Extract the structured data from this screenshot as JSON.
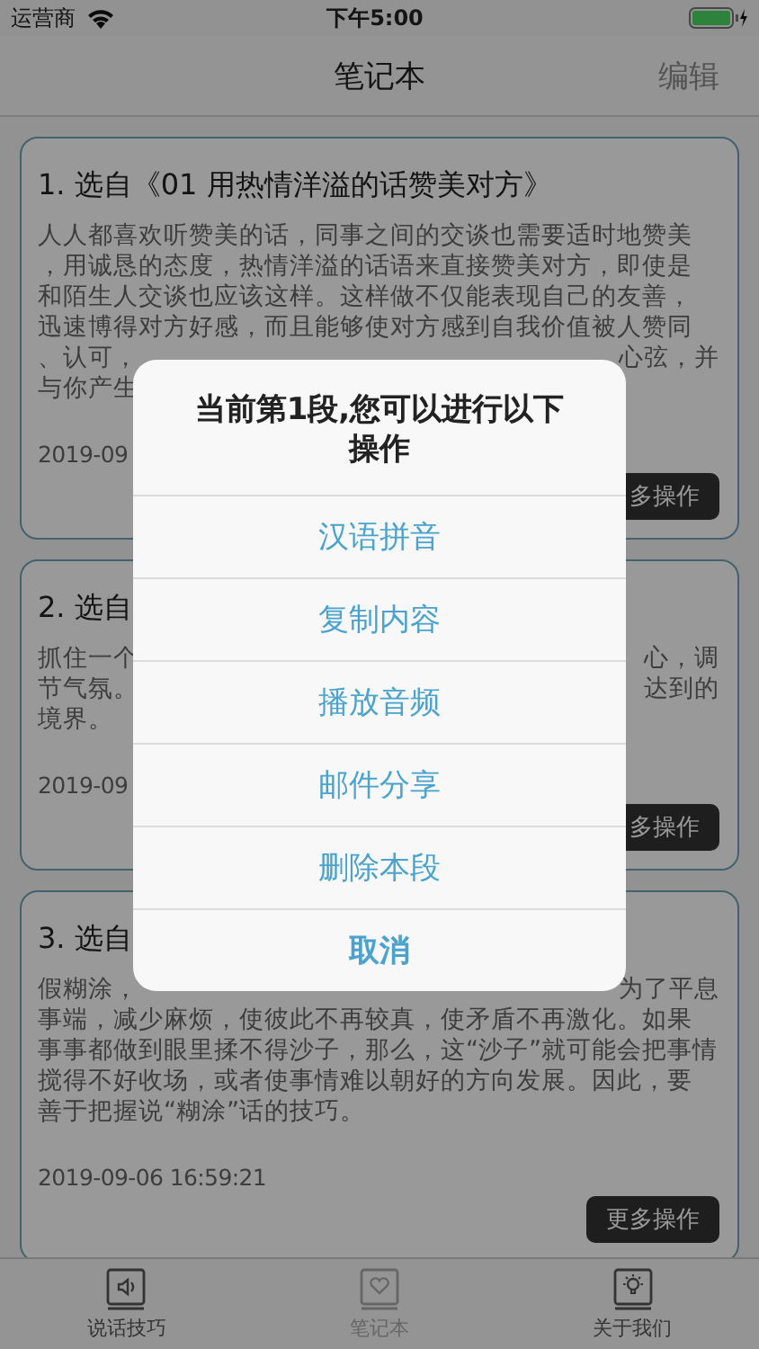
{
  "status_bar": {
    "carrier": "运营商",
    "time": "下午5:00"
  },
  "nav": {
    "title": "笔记本",
    "action": "编辑"
  },
  "cards": [
    {
      "title": "1. 选自《01 用热情洋溢的话赞美对方》",
      "lines": [
        {
          "left": "人人都喜欢听赞美的话，同事之间的交谈也需要适时地赞美"
        },
        {
          "left": "，用诚恳的态度，热情洋溢的话语来直接赞美对方，即使是"
        },
        {
          "left": "和陌生人交谈也应该这样。这样做不仅能表现自己的友善，"
        },
        {
          "left": "迅速博得对方好感，而且能够使对方感到自我价值被人赞同"
        },
        {
          "left": "、认可，",
          "right": "心弦，并"
        },
        {
          "left": "与你产生"
        }
      ],
      "date": "2019-09",
      "button": "多操作"
    },
    {
      "title": "2. 选自",
      "lines": [
        {
          "left": "抓住一个",
          "right": "心，调"
        },
        {
          "left": "节气氛。",
          "right": "达到的"
        },
        {
          "left": "境界。"
        }
      ],
      "date": "2019-09",
      "button": "多操作"
    },
    {
      "title": "3. 选自",
      "lines": [
        {
          "left": "假糊涂，",
          "right": "为了平息"
        },
        {
          "left": "事端，减少麻烦，使彼此不再较真，使矛盾不再激化。如果"
        },
        {
          "left": "事事都做到眼里揉不得沙子，那么，这“沙子”就可能会把事情"
        },
        {
          "left": "搅得不好收场，或者使事情难以朝好的方向发展。因此，要"
        },
        {
          "left": "善于把握说“糊涂”话的技巧。"
        }
      ],
      "date": "2019-09-06 16:59:21",
      "button": "更多操作"
    }
  ],
  "tabs": [
    {
      "label": "说话技巧",
      "selected": false,
      "kind": "speaker"
    },
    {
      "label": "笔记本",
      "selected": true,
      "kind": "heart"
    },
    {
      "label": "关于我们",
      "selected": false,
      "kind": "bulb"
    }
  ],
  "dialog": {
    "title": "当前第1段,您可以进行以下操作",
    "actions": [
      "汉语拼音",
      "复制内容",
      "播放音频",
      "邮件分享",
      "删除本段"
    ],
    "cancel": "取消"
  }
}
